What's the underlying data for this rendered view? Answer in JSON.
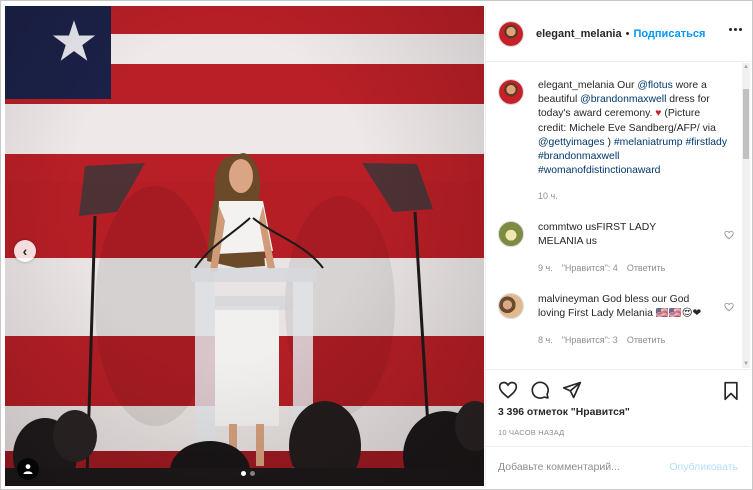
{
  "post": {
    "username": "elegant_melania",
    "follow_label": "Подписаться",
    "separator": "•",
    "caption": {
      "username": "elegant_melania",
      "parts": [
        {
          "text": " Our ",
          "link": false
        },
        {
          "text": "@flotus",
          "link": true
        },
        {
          "text": " wore a beautiful ",
          "link": false
        },
        {
          "text": "@brandonmaxwell",
          "link": true
        },
        {
          "text": " dress for today's award ceremony. ",
          "link": false
        },
        {
          "text": "♥",
          "heart": true
        },
        {
          "text": " (Picture credit: Michele Eve Sandberg/AFP/ via ",
          "link": false
        },
        {
          "text": "@gettyimages",
          "link": true
        },
        {
          "text": " ) ",
          "link": false
        },
        {
          "text": "#melaniatrump",
          "link": true
        },
        {
          "text": " ",
          "link": false
        },
        {
          "text": "#firstlady",
          "link": true
        },
        {
          "text": " ",
          "link": false
        },
        {
          "text": "#brandonmaxwell",
          "link": true
        },
        {
          "text": " ",
          "link": false
        },
        {
          "text": "#womanofdistinctionaward",
          "link": true
        }
      ],
      "time": "10 ч."
    },
    "comments": [
      {
        "username": "commtwo",
        "text": "usFIRST LADY MELANIA us",
        "time": "9 ч.",
        "likes": "\"Нравится\": 4",
        "reply": "Ответить"
      },
      {
        "username": "malvineyman",
        "text": "God bless our God loving First Lady Melania 🇺🇸🇺🇸😍❤",
        "time": "8 ч.",
        "likes": "\"Нравится\": 3",
        "reply": "Ответить"
      }
    ],
    "likes_count": "3 396 отметок",
    "likes_label": "\"Нравится\"",
    "timestamp": "10 ЧАСОВ НАЗАД",
    "comment_placeholder": "Добавьте комментарий...",
    "publish_label": "Опубликовать"
  },
  "carousel": {
    "slides": 2,
    "current": 1
  },
  "colors": {
    "link": "#00376b",
    "follow": "#0095f6",
    "publish_disabled": "#b2dffc",
    "flag_red": "#b81f26",
    "flag_blue": "#1b2147"
  },
  "icons": [
    "chevron-left-icon",
    "user-tag-icon",
    "heart-icon",
    "comment-icon",
    "share-icon",
    "bookmark-icon",
    "more-icon"
  ]
}
